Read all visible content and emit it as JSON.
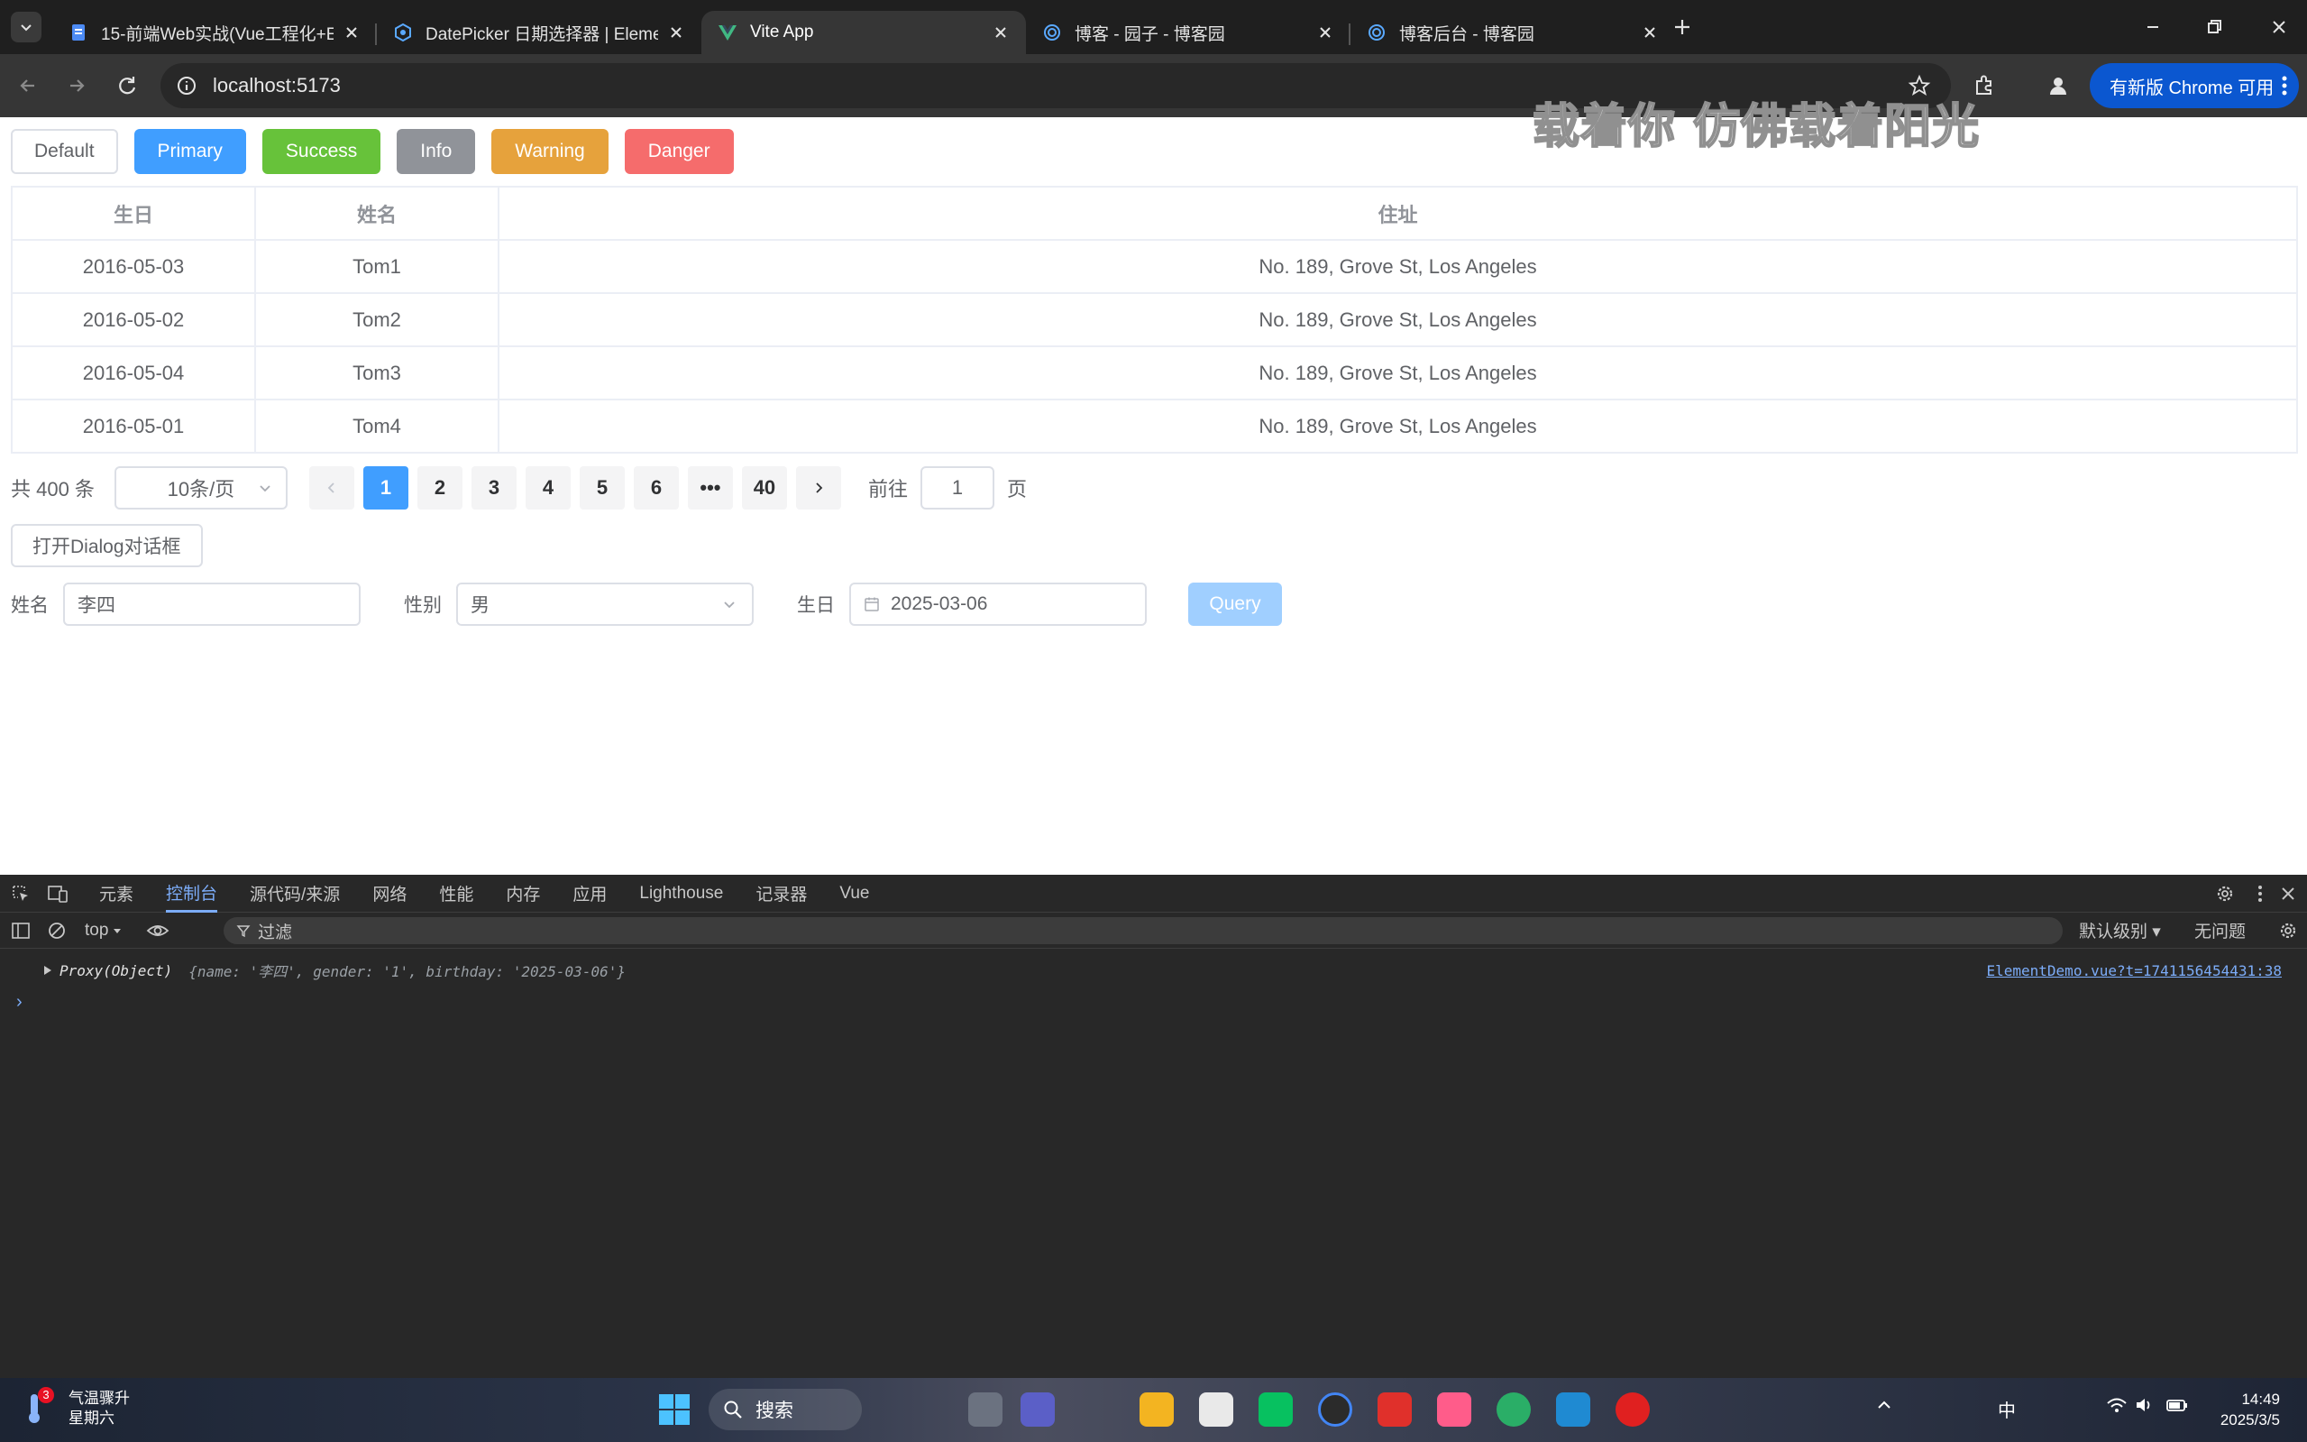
{
  "browser": {
    "tabs": [
      {
        "title": "15-前端Web实战(Vue工程化+E",
        "active": false
      },
      {
        "title": "DatePicker 日期选择器 | Eleme",
        "active": false
      },
      {
        "title": "Vite App",
        "active": true
      },
      {
        "title": "博客 - 园子 - 博客园",
        "active": false
      },
      {
        "title": "博客后台 - 博客园",
        "active": false
      }
    ],
    "url": "localhost:5173",
    "update_chip": "有新版 Chrome 可用"
  },
  "page": {
    "buttons": [
      "Default",
      "Primary",
      "Success",
      "Info",
      "Warning",
      "Danger"
    ],
    "watermark": "载着你 仿佛载着阳光",
    "table": {
      "headers": [
        "生日",
        "姓名",
        "住址"
      ],
      "rows": [
        [
          "2016-05-03",
          "Tom1",
          "No. 189, Grove St, Los Angeles"
        ],
        [
          "2016-05-02",
          "Tom2",
          "No. 189, Grove St, Los Angeles"
        ],
        [
          "2016-05-04",
          "Tom3",
          "No. 189, Grove St, Los Angeles"
        ],
        [
          "2016-05-01",
          "Tom4",
          "No. 189, Grove St, Los Angeles"
        ]
      ]
    },
    "pagination": {
      "total": "共 400 条",
      "page_size": "10条/页",
      "pages": [
        "1",
        "2",
        "3",
        "4",
        "5",
        "6",
        "•••",
        "40"
      ],
      "current": "1",
      "goto_label": "前往",
      "goto_value": "1",
      "goto_suffix": "页"
    },
    "dialog_button": "打开Dialog对话框",
    "form": {
      "name_label": "姓名",
      "name_value": "李四",
      "gender_label": "性别",
      "gender_value": "男",
      "birthday_label": "生日",
      "birthday_value": "2025-03-06",
      "query_label": "Query"
    }
  },
  "devtools": {
    "tabs": [
      "元素",
      "控制台",
      "源代码/来源",
      "网络",
      "性能",
      "内存",
      "应用",
      "Lighthouse",
      "记录器",
      "Vue"
    ],
    "active_tab": "控制台",
    "context": "top",
    "filter_placeholder": "过滤",
    "level": "默认级别",
    "issues": "无问题",
    "console": {
      "prefix": "Proxy(Object)",
      "object": "{name: '李四', gender: '1', birthday: '2025-03-06'}",
      "source": "ElementDemo.vue?t=1741156454431:38"
    }
  },
  "taskbar": {
    "weather_badge": "3",
    "weather_title": "气温骤升",
    "weather_sub": "星期六",
    "search": "搜索",
    "ime": "中",
    "time": "14:49",
    "date": "2025/3/5"
  }
}
